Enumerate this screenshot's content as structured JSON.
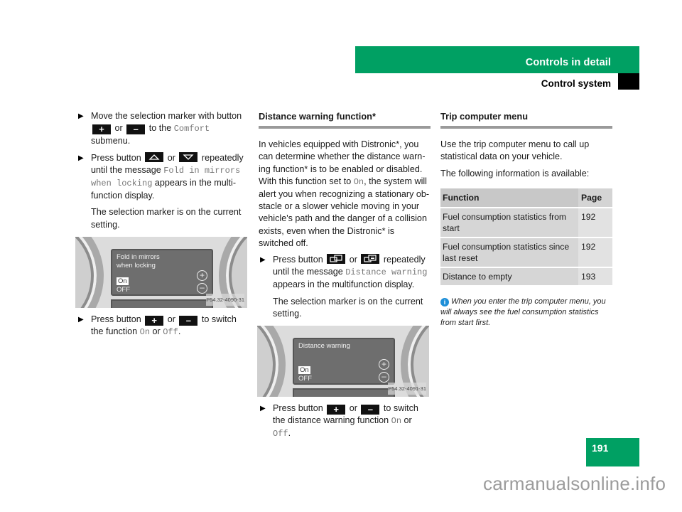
{
  "header": {
    "chapter": "Controls in detail",
    "section": "Control system",
    "accent_color": "#00a063"
  },
  "column1": {
    "step1": {
      "pre": "Move the selection marker with button",
      "btn_a": "plus",
      "or": "or",
      "btn_b": "minus",
      "mid": "to the",
      "code": "Comfort",
      "post": "submenu."
    },
    "step2": {
      "pre": "Press button",
      "btn_a": "up",
      "or": "or",
      "btn_b": "down",
      "mid": "repeatedly until the message",
      "code": "Fold in mirrors when locking",
      "post": "appears in the multi-function display."
    },
    "note": "The selection marker is on the current setting.",
    "cluster": {
      "line1": "Fold in mirrors",
      "line2": "when locking",
      "on": "On",
      "off": "OFF",
      "code": "P54.32-4090-31"
    },
    "step3": {
      "pre": "Press button",
      "or": "or",
      "mid": "to switch the function",
      "code_on": "On",
      "or2": "or",
      "code_off": "Off",
      "end": "."
    }
  },
  "column2": {
    "heading": "Distance warning function*",
    "intro_a": "In vehicles equipped with Distronic*, you can determine whether the distance warn-ing function* is to be enabled or disabled. With this function set to",
    "intro_code": "On",
    "intro_b": ", the system will alert you when recognizing a stationary ob-stacle or a slower vehicle moving in your vehicle's path and the danger of a collision exists, even when the Distronic* is switched off.",
    "step1": {
      "pre": "Press button",
      "or": "or",
      "mid": "repeatedly until the message",
      "code": "Distance warning",
      "post": "appears in the multifunction display."
    },
    "note": "The selection marker is on the current setting.",
    "cluster": {
      "line1": "Distance warning",
      "on": "On",
      "off": "OFF",
      "code": "P54.32-4091-31"
    },
    "step2": {
      "pre": "Press button",
      "or": "or",
      "mid": "to switch the distance warning function",
      "code_on": "On",
      "or2": "or",
      "code_off": "Off",
      "end": "."
    }
  },
  "column3": {
    "heading": "Trip computer menu",
    "intro1": "Use the trip computer menu to call up statistical data on your vehicle.",
    "intro2": "The following information is available:",
    "table": {
      "headers": [
        "Function",
        "Page"
      ],
      "rows": [
        [
          "Fuel consumption statistics from start",
          "192"
        ],
        [
          "Fuel consumption statistics since last reset",
          "192"
        ],
        [
          "Distance to empty",
          "193"
        ]
      ]
    },
    "info_note": "When you enter the trip computer menu, you will always see the fuel consumption statistics from start first."
  },
  "footer": {
    "page_number": "191",
    "watermark": "carmanualsonline.info"
  }
}
